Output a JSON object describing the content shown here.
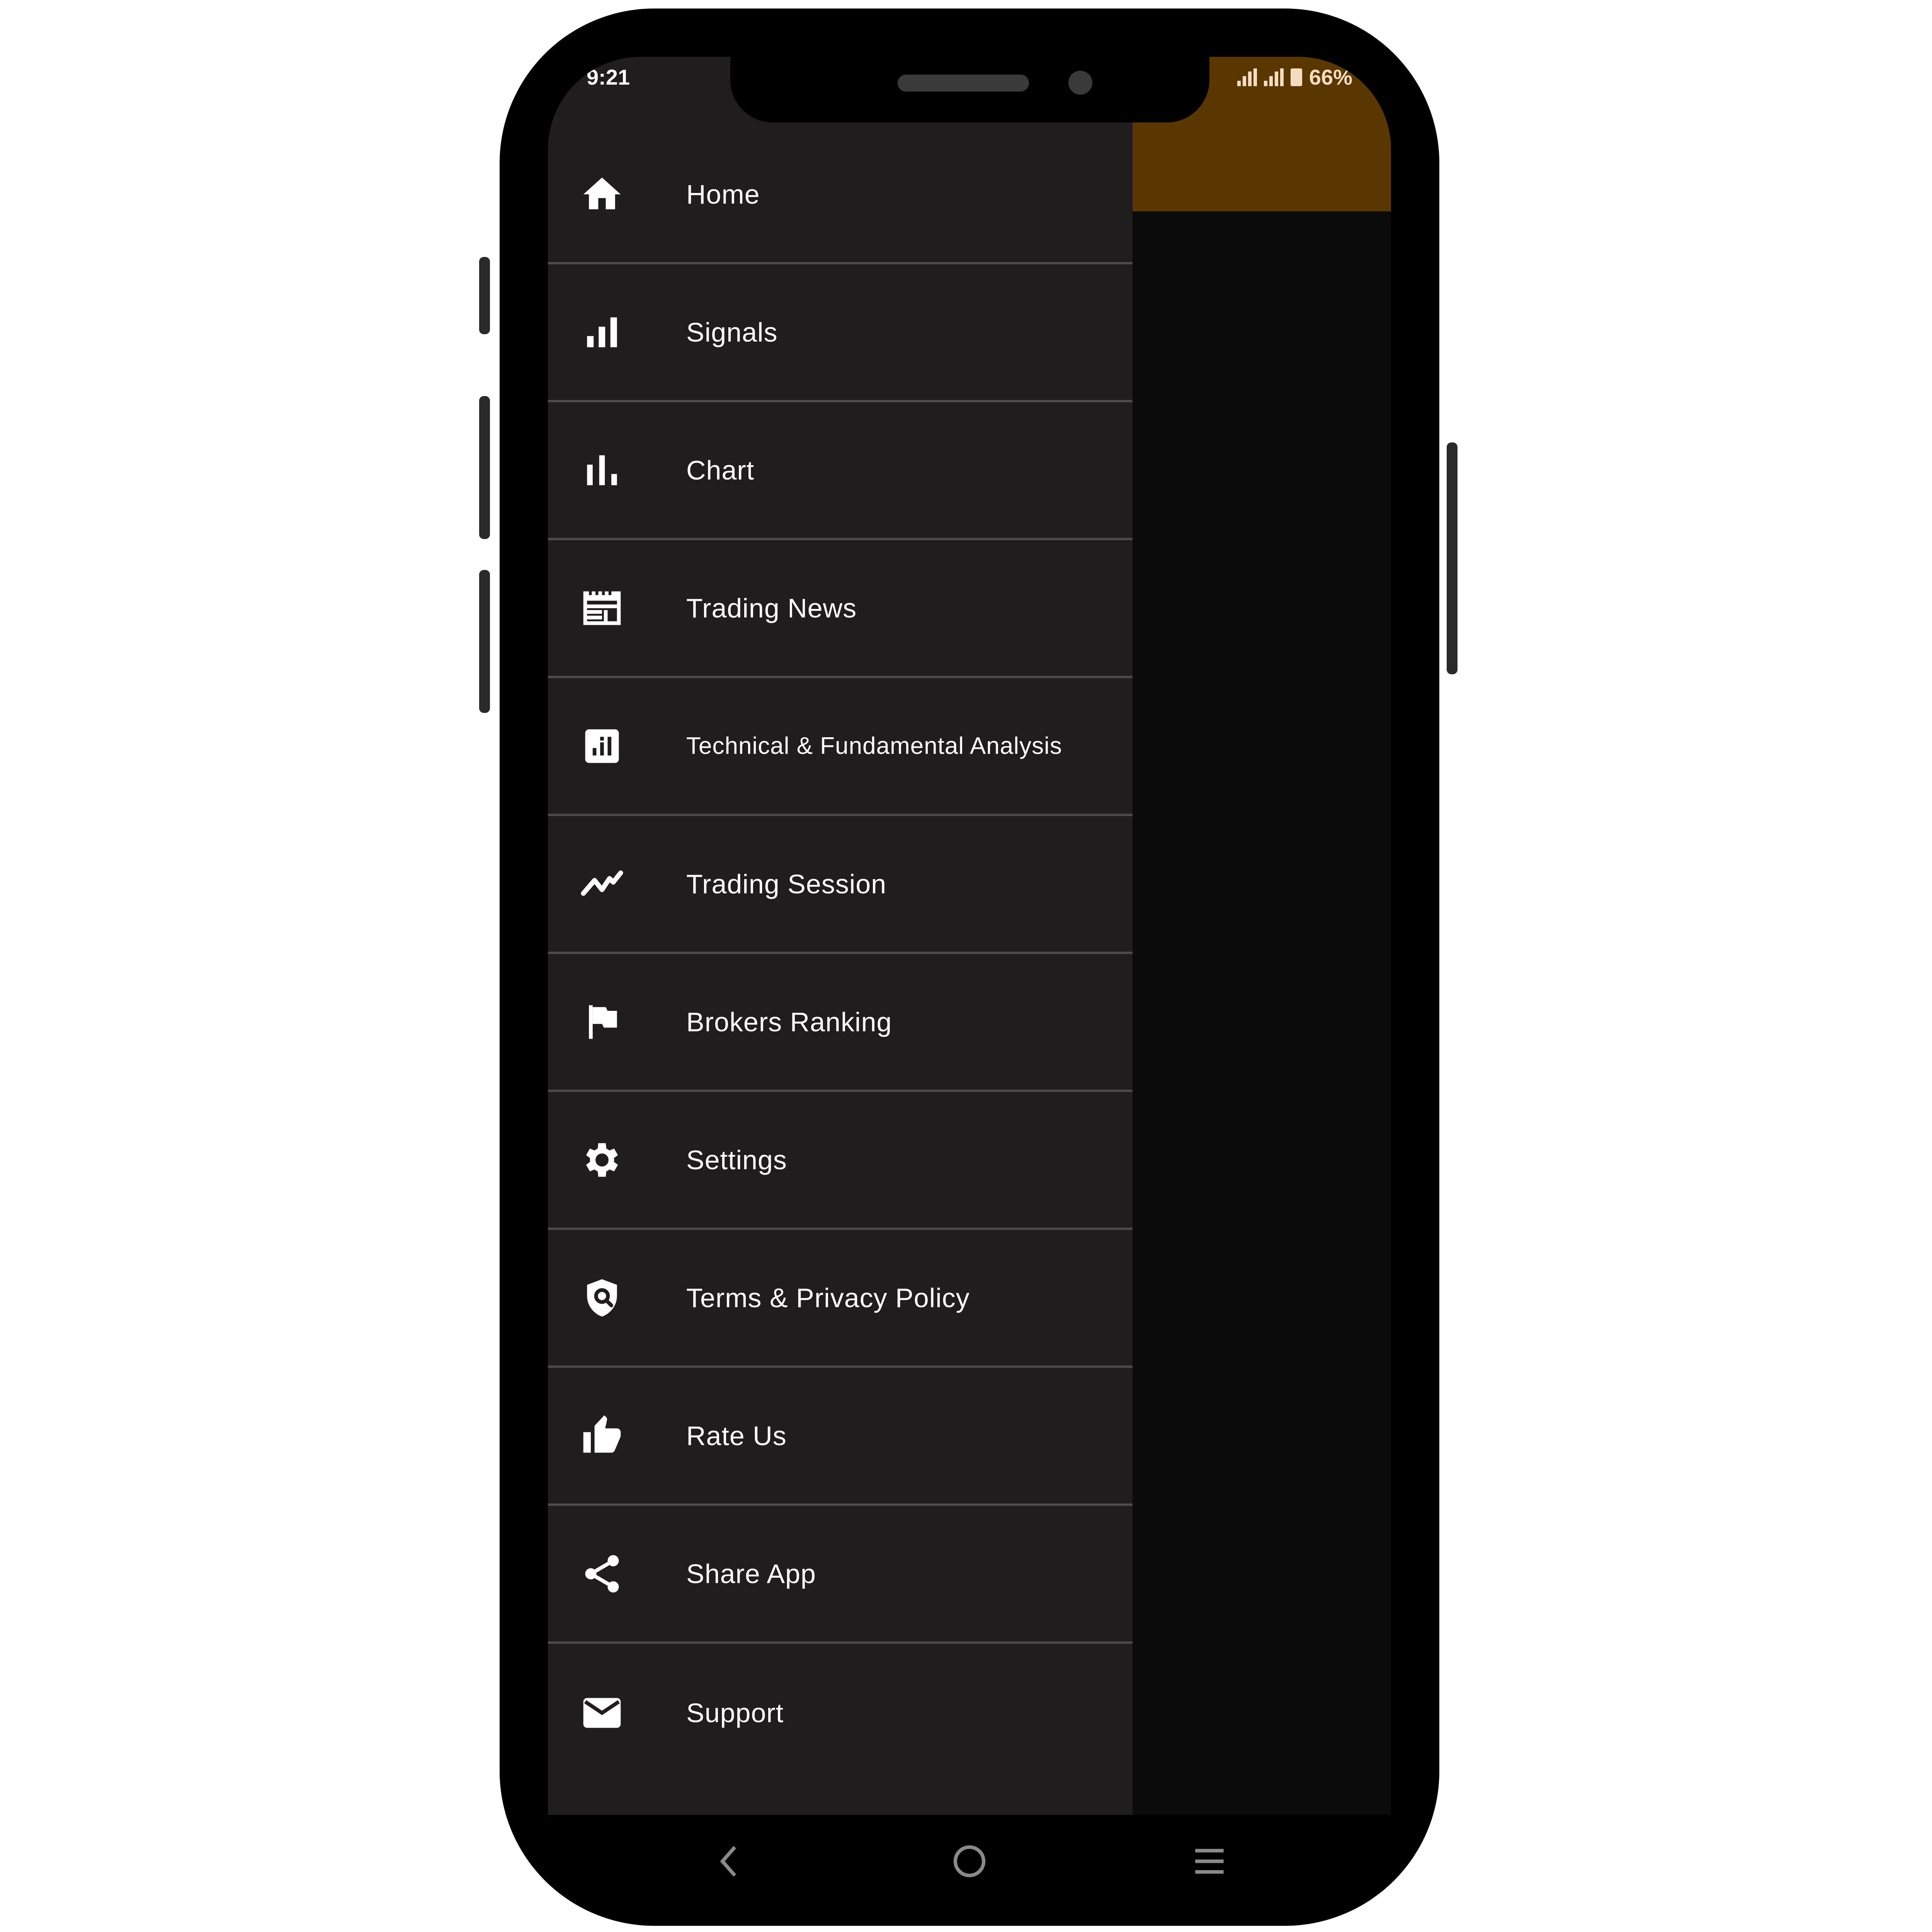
{
  "status_bar": {
    "time": "9:21",
    "battery": "66%"
  },
  "colors": {
    "drawer_bg": "#201d1e",
    "header_accent": "#5a3700",
    "divider": "#4c4a4b",
    "text": "#ffffff"
  },
  "drawer": {
    "items": [
      {
        "label": "Home",
        "icon": "home-icon"
      },
      {
        "label": "Signals",
        "icon": "signal-bars-icon"
      },
      {
        "label": "Chart",
        "icon": "bar-chart-icon"
      },
      {
        "label": "Trading News",
        "icon": "newspaper-icon"
      },
      {
        "label": "Technical & Fundamental Analysis",
        "icon": "analytics-icon"
      },
      {
        "label": "Trading Session",
        "icon": "trending-line-icon"
      },
      {
        "label": "Brokers Ranking",
        "icon": "flag-icon"
      },
      {
        "label": "Settings",
        "icon": "gear-icon"
      },
      {
        "label": "Terms & Privacy Policy",
        "icon": "shield-search-icon"
      },
      {
        "label": "Rate Us",
        "icon": "thumbs-up-icon"
      },
      {
        "label": "Share App",
        "icon": "share-icon"
      },
      {
        "label": "Support",
        "icon": "mail-icon"
      }
    ]
  },
  "nav_bar": {
    "buttons": [
      "back-icon",
      "home-circle-icon",
      "menu-lines-icon"
    ]
  }
}
